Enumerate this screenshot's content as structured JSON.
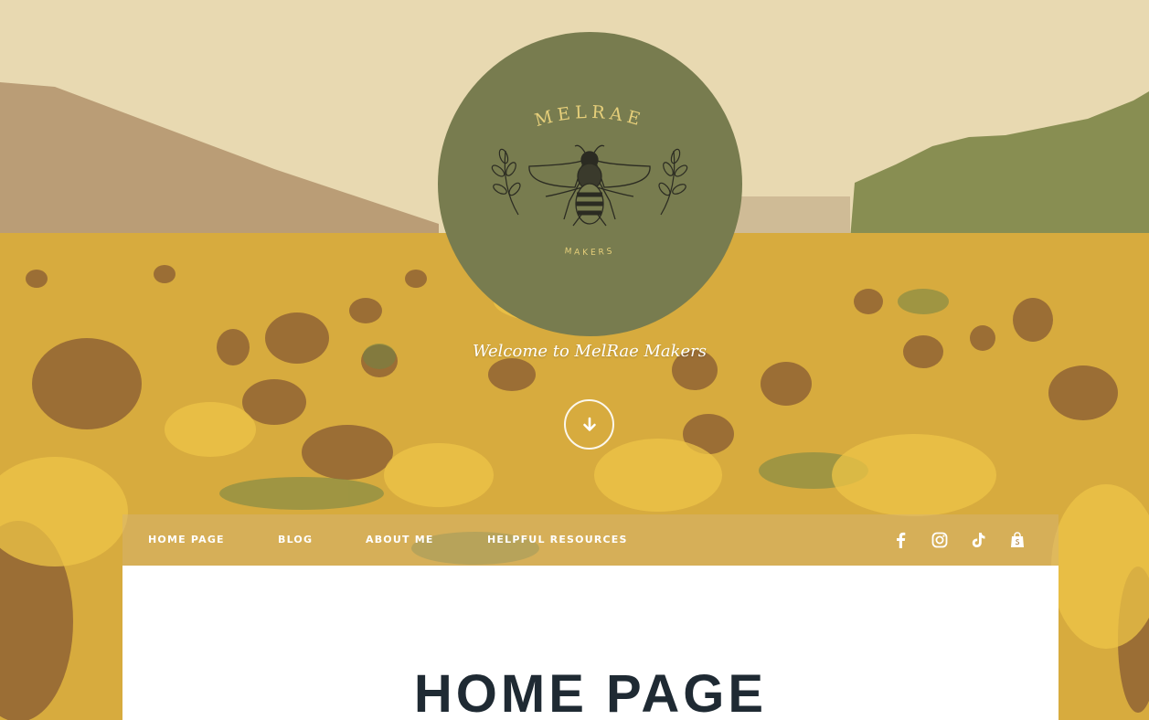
{
  "site": {
    "logo_title": "MELRAE",
    "logo_subtitle": "MAKERS",
    "tagline": "Welcome to MelRae Makers"
  },
  "nav": {
    "items": [
      {
        "label": "HOME PAGE"
      },
      {
        "label": "BLOG"
      },
      {
        "label": "ABOUT ME"
      },
      {
        "label": "HELPFUL RESOURCES"
      }
    ],
    "social": [
      "facebook-icon",
      "instagram-icon",
      "tiktok-icon",
      "shopify-icon"
    ]
  },
  "main": {
    "page_title": "HOME PAGE"
  },
  "colors": {
    "logo_bg": "#787c4f",
    "logo_text": "#e6cf7a",
    "title_text": "#1f2a33"
  }
}
